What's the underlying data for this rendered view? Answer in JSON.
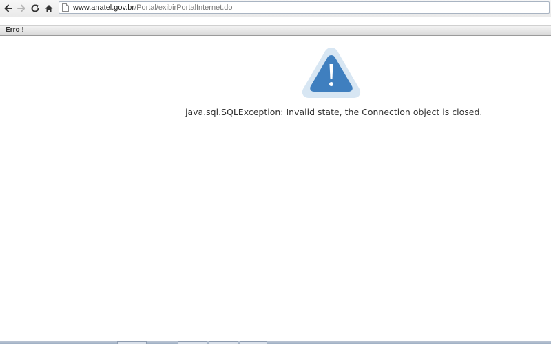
{
  "browser": {
    "url_host": "www.anatel.gov.br",
    "url_path": "/Portal/exibirPortalInternet.do",
    "icons": [
      "back-icon",
      "forward-icon",
      "reload-icon",
      "home-icon",
      "page-icon"
    ]
  },
  "page": {
    "title": "Erro !",
    "error_message": "java.sql.SQLException: Invalid state, the Connection object is closed.",
    "warning_icon": "warning-icon"
  },
  "colors": {
    "warning_blue": "#3f7fbf",
    "warning_halo": "#d7e6f3",
    "text": "#333333",
    "url_host": "#222222",
    "url_path": "#7a7a7a"
  }
}
